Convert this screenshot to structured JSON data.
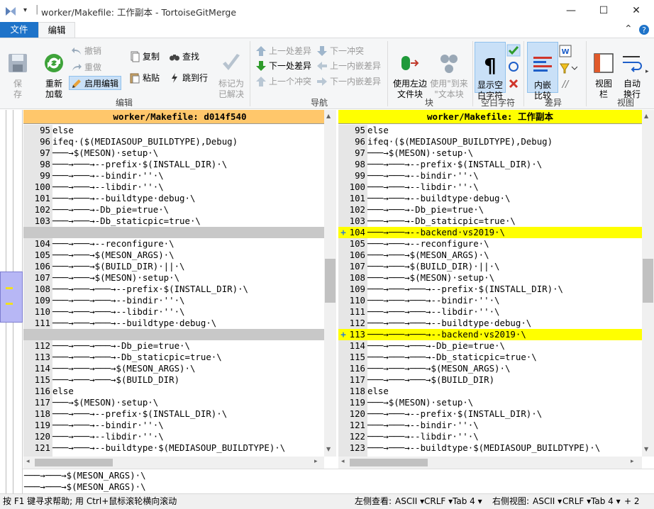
{
  "window": {
    "title": "worker/Makefile: 工作副本 - TortoiseGitMerge",
    "qat_symbol": "▾",
    "separator": "|",
    "minimize": "—",
    "maximize": "☐",
    "close": "✕"
  },
  "tabs": [
    {
      "label": "文件",
      "active": false
    },
    {
      "label": "编辑",
      "active": true
    }
  ],
  "ribbon_collapse": "⌃",
  "ribbon": {
    "save": "保\n存",
    "reload": "重新\n加载",
    "undo": "撤销",
    "redo": "重做",
    "enable_edit": "启用编辑",
    "copy": "复制",
    "paste": "粘贴",
    "find": "查找",
    "goto_line": "跳到行",
    "mark_resolved": "标记为\n已解决",
    "prev_diff": "上一处差异",
    "next_diff": "下一处差异",
    "prev_conflict": "上一个冲突",
    "next_conflict": "下一冲突",
    "prev_inline": "上一内嵌差异",
    "next_inline": "下一内嵌差异",
    "use_left": "使用左边\n文件块",
    "use_to": "使用\"到来\n\"文本块",
    "show_ws": "显示空\n白字符",
    "inline_diff": "内嵌\n比较",
    "view_bar": "视图\n栏",
    "auto_wrap": "自动\n换行",
    "groups": {
      "edit": "编辑",
      "nav": "导航",
      "block": "块",
      "whitespace": "空白字符",
      "diff": "差异",
      "view": "视图"
    }
  },
  "left_pane": {
    "header": "worker/Makefile: d014f540",
    "lines": [
      {
        "n": "95",
        "t": "else",
        "c": ""
      },
      {
        "n": "96",
        "t": "ifeq·($(MEDIASOUP_BUILDTYPE),Debug)",
        "c": ""
      },
      {
        "n": "97",
        "t": "───→$(MESON)·setup·\\",
        "c": ""
      },
      {
        "n": "98",
        "t": "───→───→--prefix·$(INSTALL_DIR)·\\",
        "c": ""
      },
      {
        "n": "99",
        "t": "───→───→--bindir·''·\\",
        "c": ""
      },
      {
        "n": "100",
        "t": "───→───→--libdir·''·\\",
        "c": ""
      },
      {
        "n": "101",
        "t": "───→───→--buildtype·debug·\\",
        "c": ""
      },
      {
        "n": "102",
        "t": "───→───→-Db_pie=true·\\",
        "c": ""
      },
      {
        "n": "103",
        "t": "───→───→-Db_staticpic=true·\\",
        "c": ""
      },
      {
        "n": "",
        "t": "",
        "c": "gray"
      },
      {
        "n": "104",
        "t": "───→───→--reconfigure·\\",
        "c": ""
      },
      {
        "n": "105",
        "t": "───→───→$(MESON_ARGS)·\\",
        "c": ""
      },
      {
        "n": "106",
        "t": "───→───→$(BUILD_DIR)·||·\\",
        "c": ""
      },
      {
        "n": "107",
        "t": "───→───→$(MESON)·setup·\\",
        "c": ""
      },
      {
        "n": "108",
        "t": "───→───→───→--prefix·$(INSTALL_DIR)·\\",
        "c": ""
      },
      {
        "n": "109",
        "t": "───→───→───→--bindir·''·\\",
        "c": ""
      },
      {
        "n": "110",
        "t": "───→───→───→--libdir·''·\\",
        "c": ""
      },
      {
        "n": "111",
        "t": "───→───→───→--buildtype·debug·\\",
        "c": ""
      },
      {
        "n": "",
        "t": "",
        "c": "gray"
      },
      {
        "n": "112",
        "t": "───→───→───→-Db_pie=true·\\",
        "c": ""
      },
      {
        "n": "113",
        "t": "───→───→───→-Db_staticpic=true·\\",
        "c": ""
      },
      {
        "n": "114",
        "t": "───→───→───→$(MESON_ARGS)·\\",
        "c": ""
      },
      {
        "n": "115",
        "t": "───→───→───→$(BUILD_DIR)",
        "c": ""
      },
      {
        "n": "116",
        "t": "else",
        "c": ""
      },
      {
        "n": "117",
        "t": "───→$(MESON)·setup·\\",
        "c": ""
      },
      {
        "n": "118",
        "t": "───→───→--prefix·$(INSTALL_DIR)·\\",
        "c": ""
      },
      {
        "n": "119",
        "t": "───→───→--bindir·''·\\",
        "c": ""
      },
      {
        "n": "120",
        "t": "───→───→--libdir·''·\\",
        "c": ""
      },
      {
        "n": "121",
        "t": "───→───→--buildtype·$(MEDIASOUP_BUILDTYPE)·\\",
        "c": ""
      }
    ]
  },
  "right_pane": {
    "header": "worker/Makefile: 工作副本",
    "lines": [
      {
        "n": "95",
        "t": "else",
        "c": ""
      },
      {
        "n": "96",
        "t": "ifeq·($(MEDIASOUP_BUILDTYPE),Debug)",
        "c": ""
      },
      {
        "n": "97",
        "t": "───→$(MESON)·setup·\\",
        "c": ""
      },
      {
        "n": "98",
        "t": "───→───→--prefix·$(INSTALL_DIR)·\\",
        "c": ""
      },
      {
        "n": "99",
        "t": "───→───→--bindir·''·\\",
        "c": ""
      },
      {
        "n": "100",
        "t": "───→───→--libdir·''·\\",
        "c": ""
      },
      {
        "n": "101",
        "t": "───→───→--buildtype·debug·\\",
        "c": ""
      },
      {
        "n": "102",
        "t": "───→───→-Db_pie=true·\\",
        "c": ""
      },
      {
        "n": "103",
        "t": "───→───→-Db_staticpic=true·\\",
        "c": ""
      },
      {
        "n": "104",
        "t": "───→───→--backend·vs2019·\\",
        "c": "yel",
        "m": "+"
      },
      {
        "n": "105",
        "t": "───→───→--reconfigure·\\",
        "c": ""
      },
      {
        "n": "106",
        "t": "───→───→$(MESON_ARGS)·\\",
        "c": ""
      },
      {
        "n": "107",
        "t": "───→───→$(BUILD_DIR)·||·\\",
        "c": ""
      },
      {
        "n": "108",
        "t": "───→───→$(MESON)·setup·\\",
        "c": ""
      },
      {
        "n": "109",
        "t": "───→───→───→--prefix·$(INSTALL_DIR)·\\",
        "c": ""
      },
      {
        "n": "110",
        "t": "───→───→───→--bindir·''·\\",
        "c": ""
      },
      {
        "n": "111",
        "t": "───→───→───→--libdir·''·\\",
        "c": ""
      },
      {
        "n": "112",
        "t": "───→───→───→--buildtype·debug·\\",
        "c": ""
      },
      {
        "n": "113",
        "t": "───→───→───→--backend·vs2019·\\",
        "c": "yel",
        "m": "+"
      },
      {
        "n": "114",
        "t": "───→───→───→-Db_pie=true·\\",
        "c": ""
      },
      {
        "n": "115",
        "t": "───→───→───→-Db_staticpic=true·\\",
        "c": ""
      },
      {
        "n": "116",
        "t": "───→───→───→$(MESON_ARGS)·\\",
        "c": ""
      },
      {
        "n": "117",
        "t": "───→───→───→$(BUILD_DIR)",
        "c": ""
      },
      {
        "n": "118",
        "t": "else",
        "c": ""
      },
      {
        "n": "119",
        "t": "───→$(MESON)·setup·\\",
        "c": ""
      },
      {
        "n": "120",
        "t": "───→───→--prefix·$(INSTALL_DIR)·\\",
        "c": ""
      },
      {
        "n": "121",
        "t": "───→───→--bindir·''·\\",
        "c": ""
      },
      {
        "n": "122",
        "t": "───→───→--libdir·''·\\",
        "c": ""
      },
      {
        "n": "123",
        "t": "───→───→--buildtype·$(MEDIASOUP_BUILDTYPE)·\\",
        "c": ""
      }
    ]
  },
  "bottom_lines": [
    "───→───→$(MESON_ARGS)·\\",
    "───→───→$(MESON_ARGS)·\\"
  ],
  "status": {
    "help": "按 F1 键寻求帮助; 用 Ctrl+鼠标滚轮横向滚动",
    "left_view_label": "左侧查看:",
    "left_encoding": "ASCII",
    "left_eol": "CRLF",
    "left_tab": "Tab 4",
    "right_view_label": "右侧视图:",
    "right_encoding": "ASCII",
    "right_eol": "CRLF",
    "right_tab": "Tab 4",
    "diff_count": "+ 2"
  },
  "colors": {
    "left_header": "#ffc76b",
    "right_header": "#ffff00",
    "added": "#ffff00",
    "placeholder": "#c8c8c8",
    "accent": "#1e73c9"
  }
}
